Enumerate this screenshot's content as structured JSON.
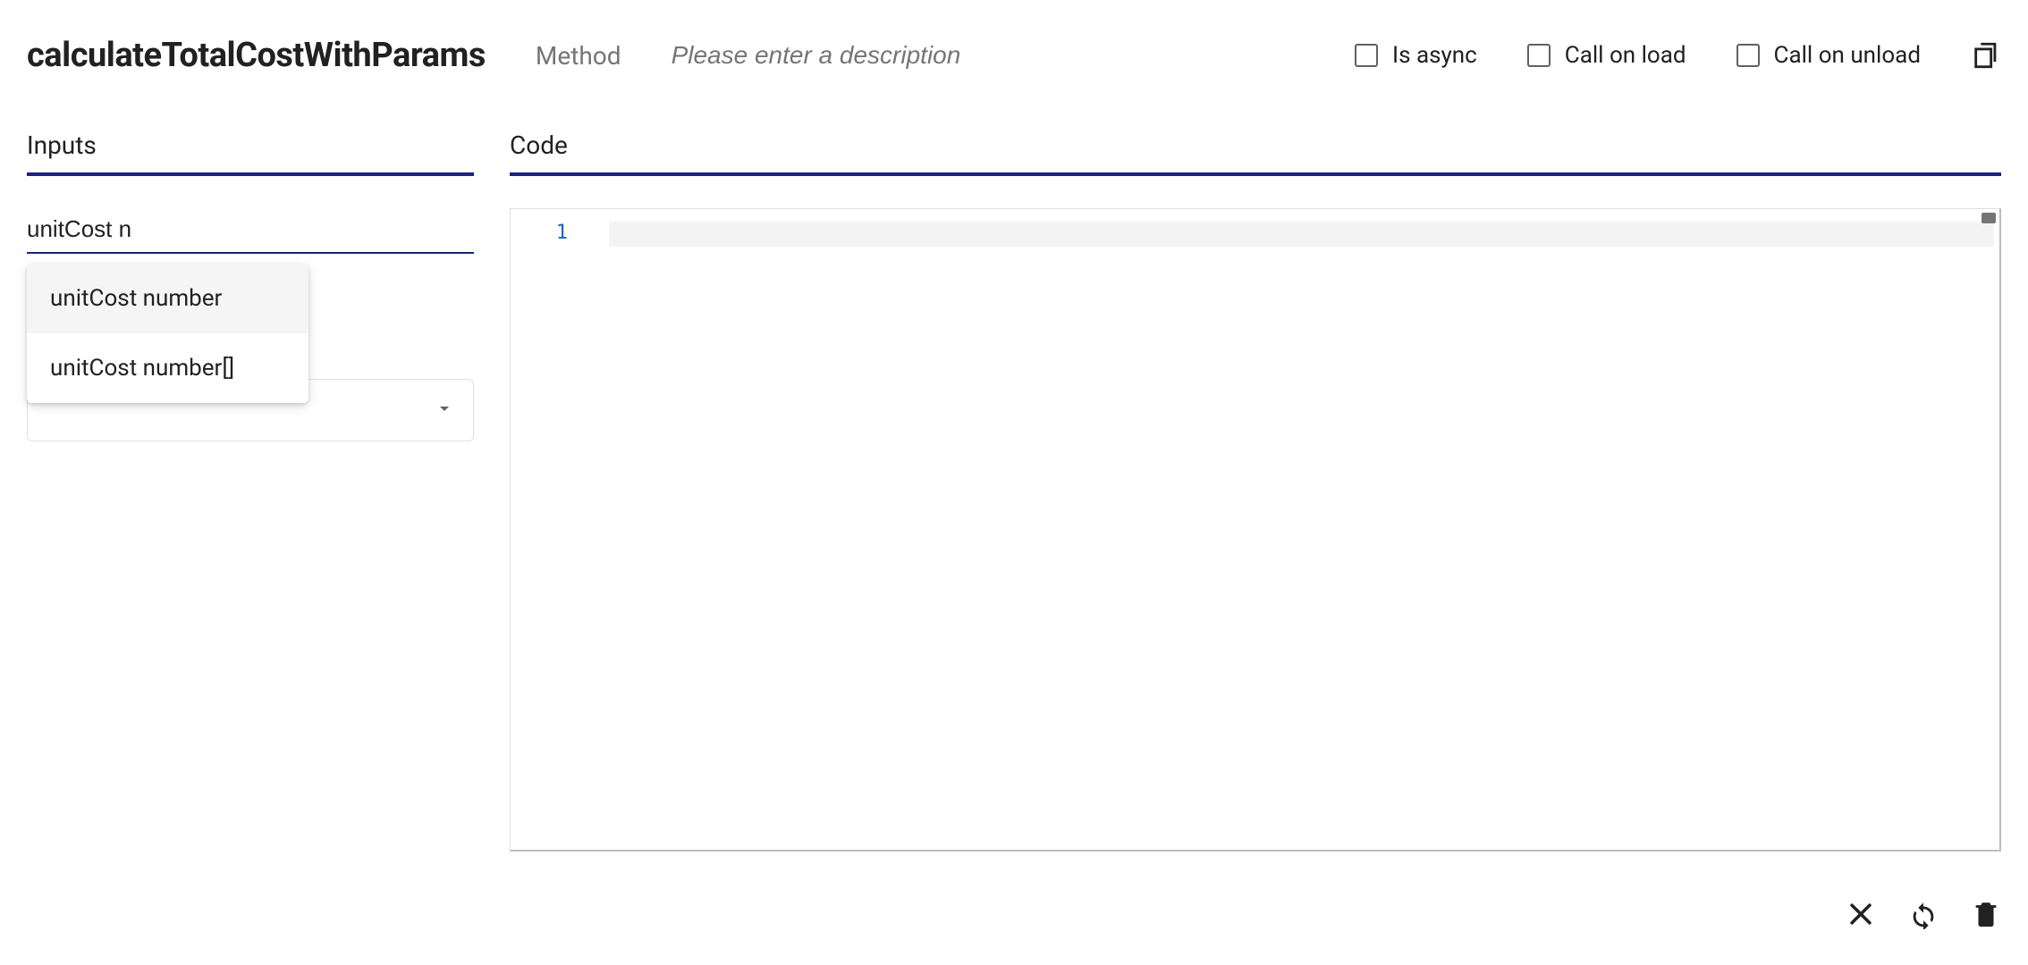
{
  "header": {
    "methodName": "calculateTotalCostWithParams",
    "typeLabel": "Method",
    "descriptionPlaceholder": "Please enter a description",
    "checkboxes": {
      "isAsync": "Is async",
      "callOnLoad": "Call on load",
      "callOnUnload": "Call on unload"
    }
  },
  "sections": {
    "inputs": "Inputs",
    "code": "Code"
  },
  "inputs": {
    "paramValue": "unitCost n",
    "autocomplete": [
      "unitCost number",
      "unitCost number[]"
    ]
  },
  "code": {
    "lineNumbers": [
      "1"
    ]
  }
}
